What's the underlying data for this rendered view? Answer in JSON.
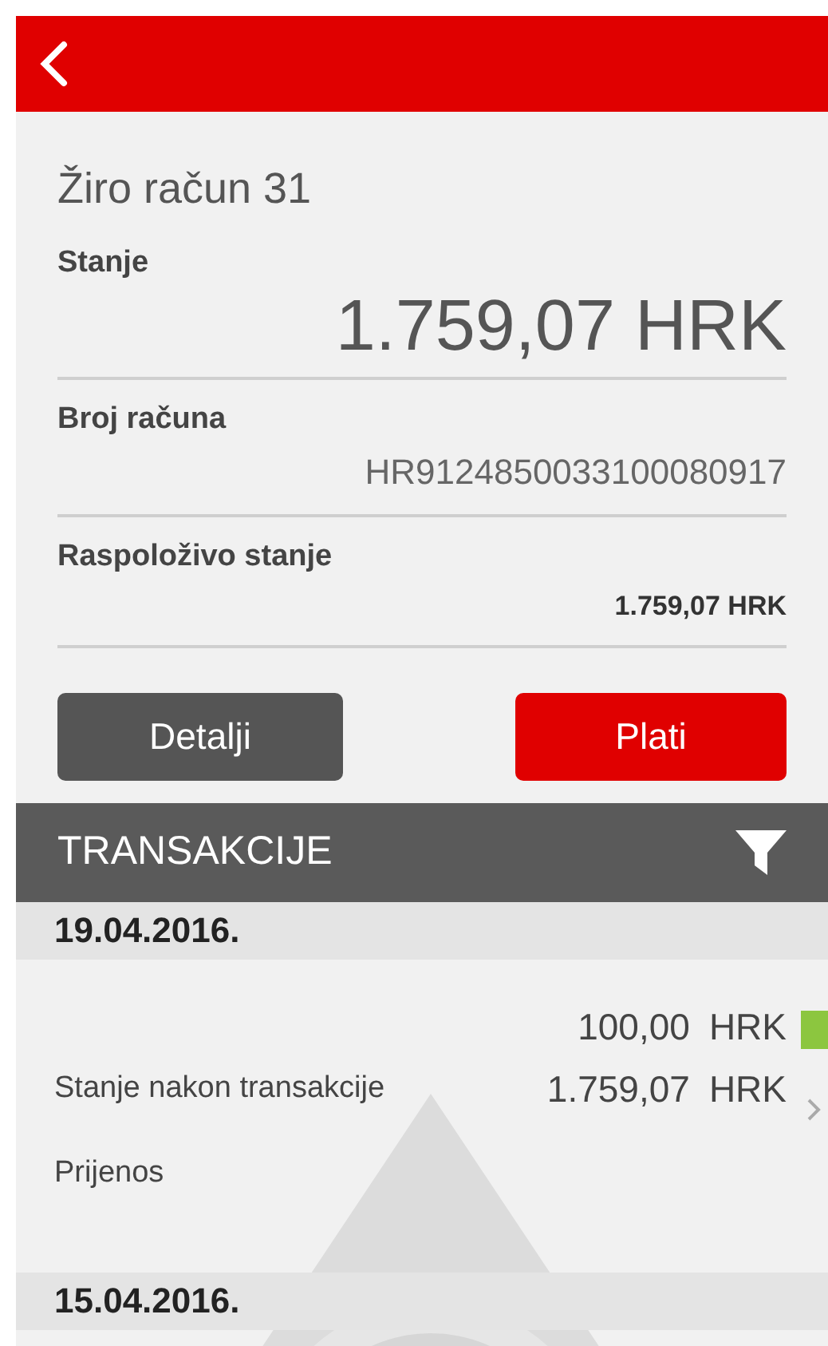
{
  "account": {
    "title": "Žiro račun 31",
    "fields": [
      {
        "kind": "large",
        "label": "Stanje",
        "value": "1.759,07 HRK"
      },
      {
        "kind": "plain",
        "label": "Broj računa",
        "value": "HR9124850033100080917"
      },
      {
        "kind": "bold",
        "label": "Raspoloživo stanje",
        "value": "1.759,07 HRK"
      }
    ]
  },
  "buttons": [
    {
      "kind": "secondary",
      "label": "Detalji"
    },
    {
      "kind": "primary",
      "label": "Plati"
    }
  ],
  "transactions": {
    "title": "TRANSAKCIJE",
    "groups": [
      {
        "date": "19.04.2016.",
        "items": [
          {
            "amount": "100,00",
            "currency": "HRK",
            "color": "#8cc63f",
            "balance_label": "Stanje nakon transakcije",
            "balance": "1.759,07",
            "balance_currency": "HRK",
            "description": "Prijenos"
          }
        ]
      },
      {
        "date": "15.04.2016."
      }
    ]
  }
}
